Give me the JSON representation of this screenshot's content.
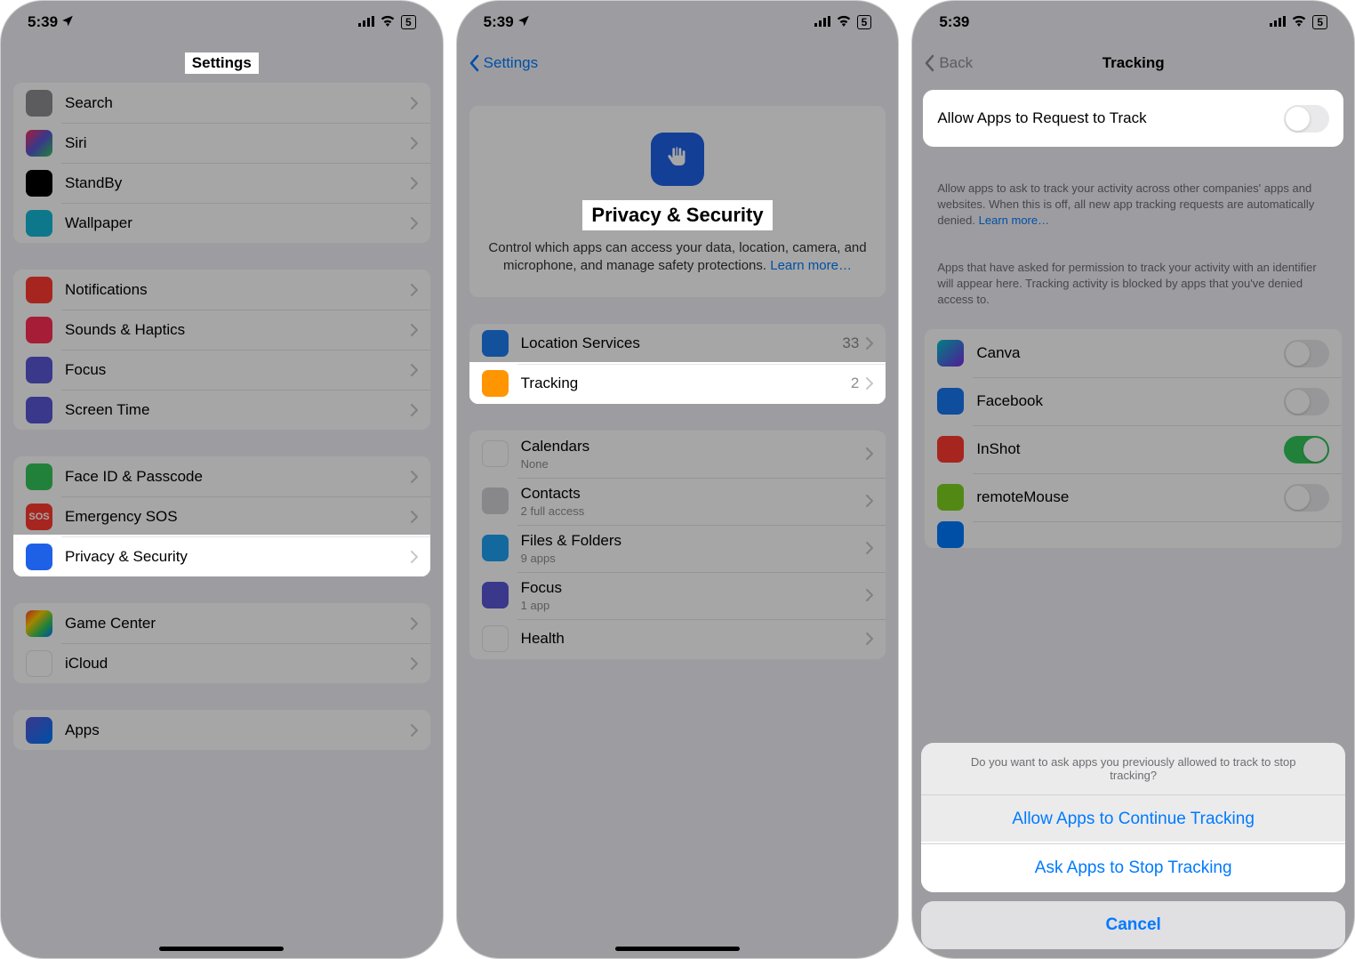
{
  "status": {
    "time": "5:39",
    "signal_icon": "signal-icon",
    "wifi_icon": "wifi-icon",
    "battery_label": "5"
  },
  "screen1": {
    "title": "Settings",
    "group1": [
      {
        "icon": "ic-gray",
        "name": "search-icon",
        "label": "Search"
      },
      {
        "icon": "ic-siri",
        "name": "siri-icon",
        "label": "Siri"
      },
      {
        "icon": "ic-standby",
        "name": "standby-icon",
        "label": "StandBy"
      },
      {
        "icon": "ic-wallpaper",
        "name": "wallpaper-icon",
        "label": "Wallpaper"
      }
    ],
    "group2": [
      {
        "icon": "ic-notif",
        "name": "bell-icon",
        "label": "Notifications"
      },
      {
        "icon": "ic-sounds",
        "name": "speaker-icon",
        "label": "Sounds & Haptics"
      },
      {
        "icon": "ic-focus",
        "name": "moon-icon",
        "label": "Focus"
      },
      {
        "icon": "ic-screentime",
        "name": "hourglass-icon",
        "label": "Screen Time"
      }
    ],
    "group3": [
      {
        "icon": "ic-faceid",
        "name": "faceid-icon",
        "label": "Face ID & Passcode"
      },
      {
        "icon": "ic-sos",
        "name": "sos-icon",
        "label": "Emergency SOS",
        "text": "SOS"
      },
      {
        "icon": "ic-privacy",
        "name": "hand-icon",
        "label": "Privacy & Security",
        "highlight": true
      }
    ],
    "group4": [
      {
        "icon": "ic-gamecenter",
        "name": "gamecenter-icon",
        "label": "Game Center"
      },
      {
        "icon": "ic-icloud",
        "name": "cloud-icon",
        "label": "iCloud"
      }
    ],
    "group5": [
      {
        "icon": "ic-apps",
        "name": "apps-icon",
        "label": "Apps"
      }
    ]
  },
  "screen2": {
    "back": "Settings",
    "hero": {
      "title": "Privacy & Security",
      "desc": "Control which apps can access your data, location, camera, and microphone, and manage safety protections.",
      "link": "Learn more…"
    },
    "groupA": [
      {
        "icon": "ic-location",
        "name": "location-icon",
        "label": "Location Services",
        "detail": "33"
      },
      {
        "icon": "ic-tracking",
        "name": "tracking-icon",
        "label": "Tracking",
        "detail": "2",
        "highlight": true
      }
    ],
    "groupB": [
      {
        "icon": "ic-calendar",
        "name": "calendar-icon",
        "label": "Calendars",
        "sub": "None"
      },
      {
        "icon": "ic-contacts",
        "name": "contacts-icon",
        "label": "Contacts",
        "sub": "2 full access"
      },
      {
        "icon": "ic-files",
        "name": "folder-icon",
        "label": "Files & Folders",
        "sub": "9 apps"
      },
      {
        "icon": "ic-focus",
        "name": "moon-icon",
        "label": "Focus",
        "sub": "1 app"
      },
      {
        "icon": "ic-health",
        "name": "heart-icon",
        "label": "Health",
        "sub": ""
      }
    ]
  },
  "screen3": {
    "back": "Back",
    "title": "Tracking",
    "allow_row": {
      "label": "Allow Apps to Request to Track"
    },
    "desc1": "Allow apps to ask to track your activity across other companies' apps and websites. When this is off, all new app tracking requests are automatically denied.",
    "desc1_link": "Learn more…",
    "desc2": "Apps that have asked for permission to track your activity with an identifier will appear here. Tracking activity is blocked by apps that you've denied access to.",
    "apps": [
      {
        "icon": "ic-canva",
        "name": "canva-icon",
        "label": "Canva",
        "on": false
      },
      {
        "icon": "ic-fb",
        "name": "facebook-icon",
        "label": "Facebook",
        "on": false
      },
      {
        "icon": "ic-inshot",
        "name": "inshot-icon",
        "label": "InShot",
        "on": true
      },
      {
        "icon": "ic-remote",
        "name": "remotemouse-icon",
        "label": "remoteMouse",
        "on": false
      }
    ],
    "sheet": {
      "message": "Do you want to ask apps you previously allowed to track to stop tracking?",
      "opt1": "Allow Apps to Continue Tracking",
      "opt2": "Ask Apps to Stop Tracking",
      "cancel": "Cancel"
    }
  }
}
